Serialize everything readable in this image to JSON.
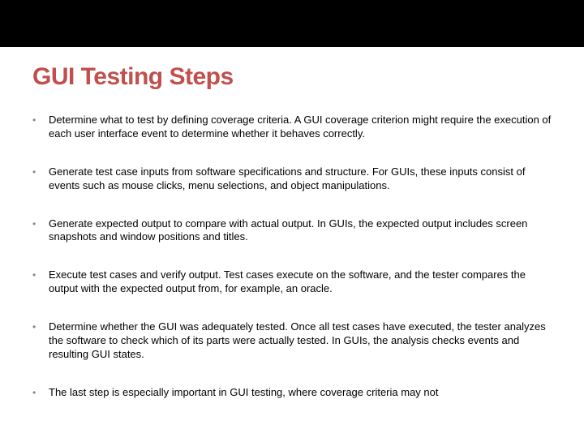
{
  "slide": {
    "title": "GUI Testing Steps",
    "bullets": [
      "Determine what to test by defining coverage criteria. A GUI coverage criterion might require the execution of each user interface event to determine whether it behaves correctly.",
      "Generate test case inputs from software specifications and structure. For GUIs, these inputs consist of events such as mouse clicks, menu selections, and object manipulations.",
      "Generate expected output to compare with actual output. In GUIs, the expected output includes screen snapshots and window positions and titles.",
      "Execute test cases and verify output. Test cases execute on the software, and the tester compares the output with the expected output from, for example, an oracle.",
      "Determine whether the GUI was adequately tested. Once all test cases have executed, the tester analyzes the software to check which of its parts were actually tested. In GUIs, the analysis checks events and resulting GUI states.",
      "The last step is especially important in GUI testing, where coverage criteria may not"
    ]
  }
}
